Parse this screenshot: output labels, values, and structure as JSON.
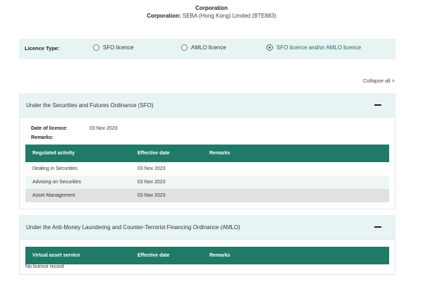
{
  "header": {
    "title": "Corporation",
    "corp_label": "Corporation:",
    "corp_value": "SEBA (Hong Kong) Limited (BTE883)"
  },
  "licence_type": {
    "label": "Licence Type:",
    "options": [
      {
        "label": "SFO licence",
        "selected": false
      },
      {
        "label": "AMLO licence",
        "selected": false
      },
      {
        "label": "SFO licence and/or AMLO licence",
        "selected": true
      }
    ]
  },
  "collapse_all": "Collapse all >",
  "sfo": {
    "title": "Under the Securities and Futures Ordinance (SFO)",
    "date_label": "Date of licence:",
    "date_value": "03 Nov 2023",
    "remarks_label": "Remarks:",
    "columns": [
      "Regulated activity",
      "Effective date",
      "Remarks"
    ],
    "rows": [
      {
        "activity": "Dealing in Securities",
        "date": "03 Nov 2023",
        "remarks": ""
      },
      {
        "activity": "Advising on Securities",
        "date": "03 Nov 2023",
        "remarks": ""
      },
      {
        "activity": "Asset Management",
        "date": "03 Nov 2023",
        "remarks": ""
      }
    ]
  },
  "amlo": {
    "title": "Under the Anti-Money Laundering and Counter-Terrorist Financing Ordinance (AMLO)",
    "columns": [
      "Virtual asset service",
      "Effective date",
      "Remarks"
    ],
    "empty_text": "No licence record"
  },
  "colors": {
    "accent": "#1f7a67",
    "panel": "#e7f4f3",
    "row_alt": "#eef7f5",
    "row_highlight": "#e1e1e1"
  }
}
